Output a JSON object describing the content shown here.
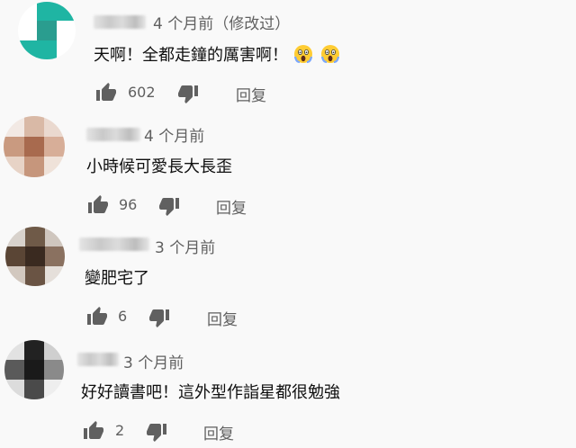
{
  "comments": [
    {
      "time": "4 个月前（修改过）",
      "text": "天啊！全都走鐘的厲害啊！",
      "emoji": [
        "scream-emoji",
        "scream-emoji"
      ],
      "likes": "602",
      "reply_label": "回复",
      "avatar_colors": [
        "#ffffff",
        "#1fb5a3",
        "#1fb5a3",
        "#ffffff",
        "#2a9d8f",
        "#ffffff",
        "#1fb5a3",
        "#1fb5a3",
        "#ffffff"
      ]
    },
    {
      "time": "4 个月前",
      "text": "小時候可愛長大長歪",
      "likes": "96",
      "reply_label": "回复",
      "avatar_colors": [
        "#f2e9e4",
        "#d9b9a6",
        "#ead9cf",
        "#c99a80",
        "#a86a4e",
        "#d7ae98",
        "#e7d3c6",
        "#c6967c",
        "#efe2d9"
      ]
    },
    {
      "time": "3 个月前",
      "text": "變肥宅了",
      "likes": "6",
      "reply_label": "回复",
      "avatar_colors": [
        "#d8d2cc",
        "#6f5a48",
        "#cfc6be",
        "#5a4535",
        "#3a2a20",
        "#8a7160",
        "#d2c8bf",
        "#6a5444",
        "#e5dfda"
      ]
    },
    {
      "time": "3 个月前",
      "text": "好好讀書吧！這外型作詣星都很勉強",
      "likes": "2",
      "reply_label": "回复",
      "avatar_colors": [
        "#e2e2e2",
        "#222222",
        "#cfcfcf",
        "#5a5a5a",
        "#1a1a1a",
        "#8a8a8a",
        "#dcdcdc",
        "#4a4a4a",
        "#eeeeee"
      ]
    }
  ]
}
